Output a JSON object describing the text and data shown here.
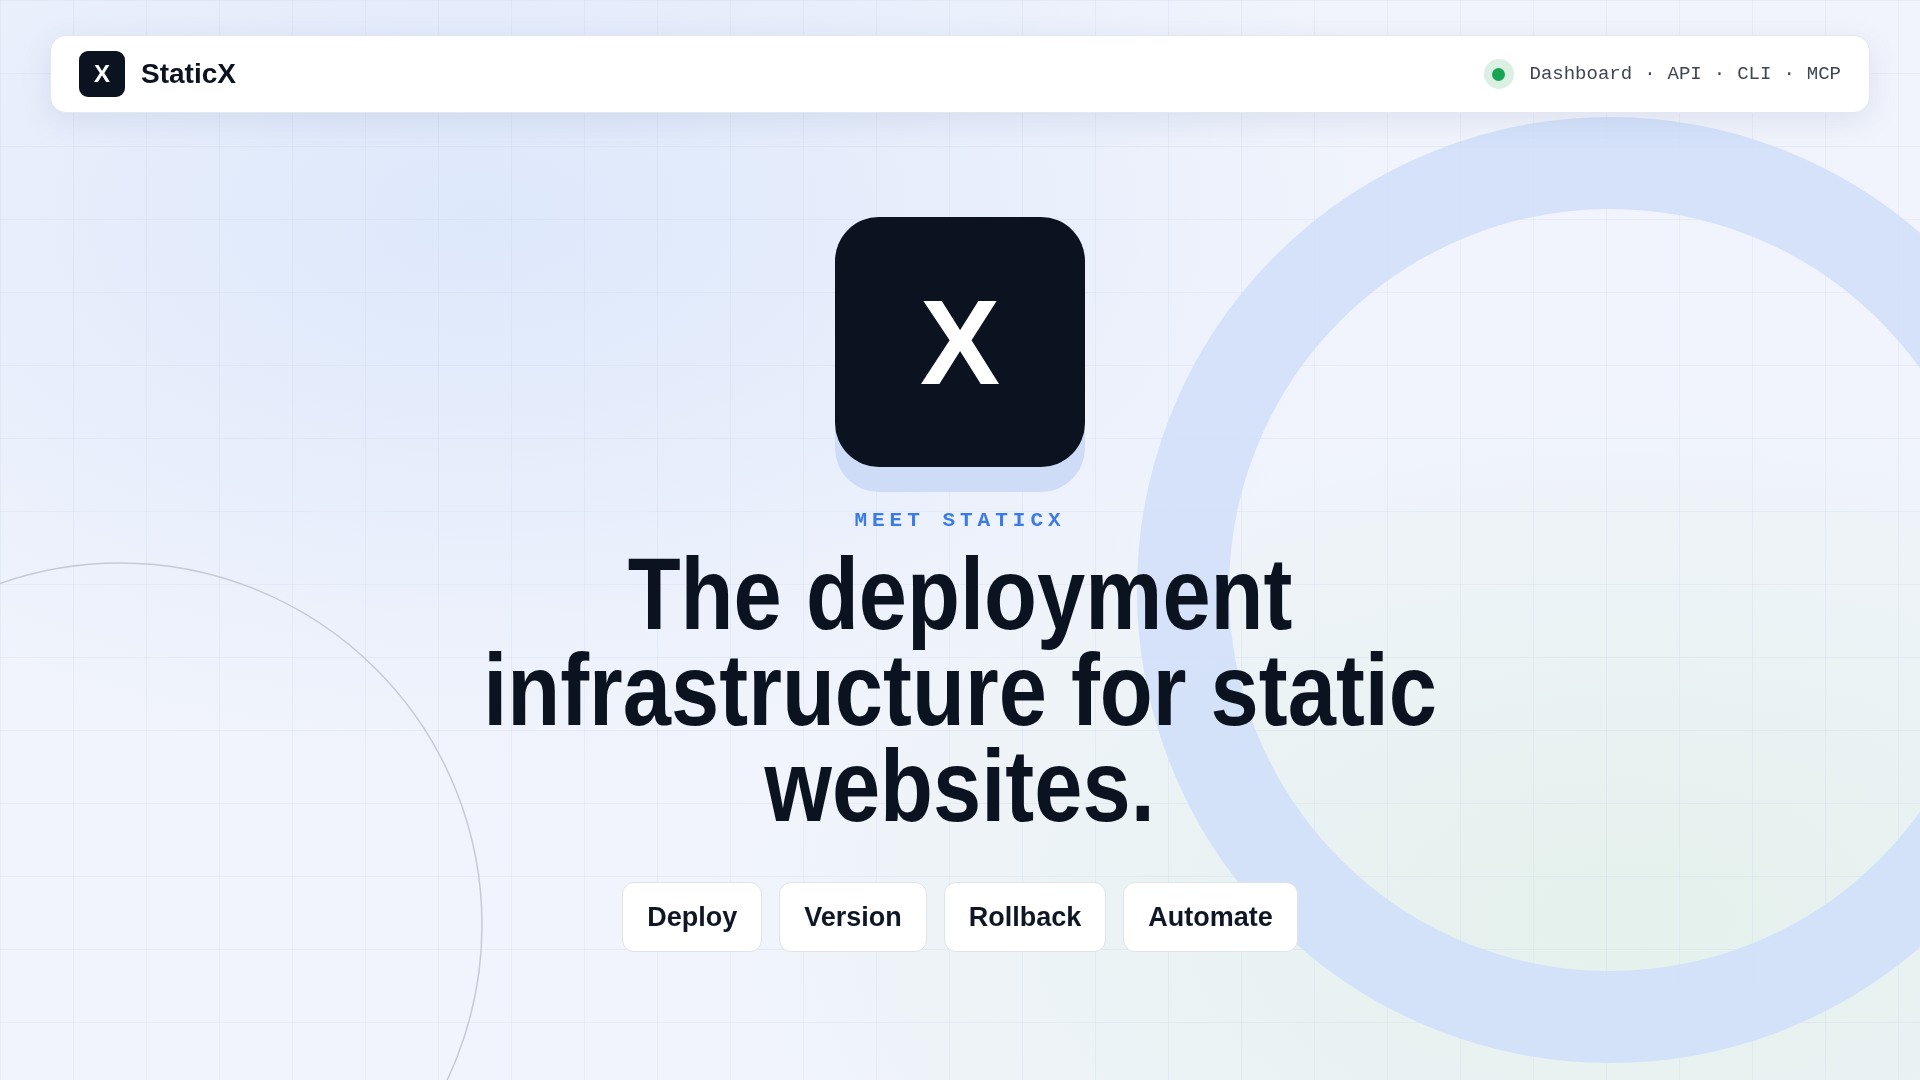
{
  "header": {
    "logo_letter": "X",
    "brand": "StaticX",
    "status_online": true,
    "separator": "·",
    "links": [
      "Dashboard",
      "API",
      "CLI",
      "MCP"
    ]
  },
  "hero": {
    "icon_letter": "X",
    "eyebrow": "MEET STATICX",
    "title_lines": [
      "The deployment",
      "infrastructure for static",
      "websites."
    ],
    "buttons": [
      "Deploy",
      "Version",
      "Rollback",
      "Automate"
    ]
  }
}
